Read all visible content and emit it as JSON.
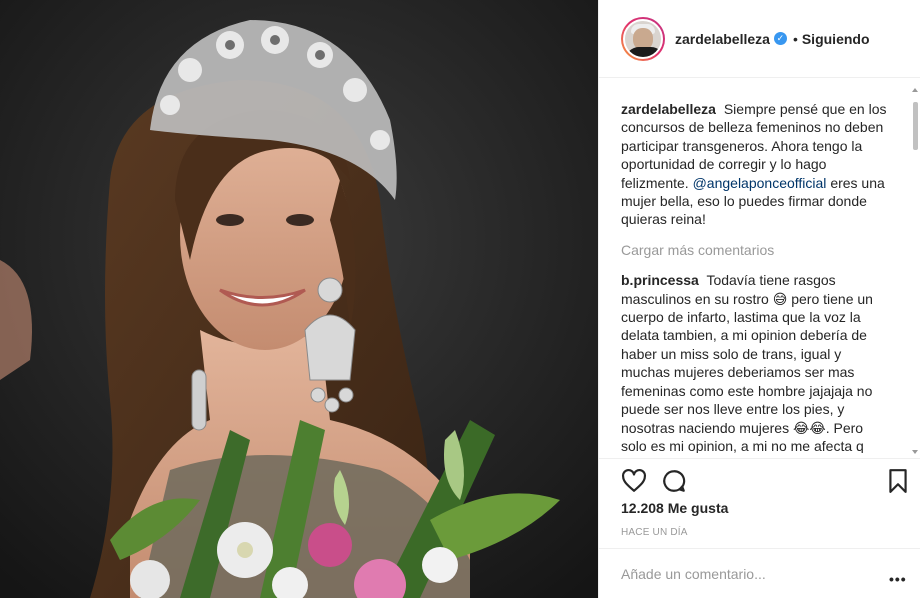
{
  "post": {
    "image_alt": "Mujer sonriente con corona y aretes largos, sosteniendo un ramo de flores"
  },
  "header": {
    "username": "zardelabelleza",
    "verified_mark": "✓",
    "separator": "•",
    "follow_label": "Siguiendo",
    "avatar_icon": "profile-avatar"
  },
  "caption": {
    "author": "zardelabelleza",
    "text_before": "Siempre pensé que en los concursos de belleza femeninos no deben participar transgeneros. Ahora tengo la oportunidad de corregir y lo hago felizmente.",
    "mention": "@angelaponceofficial",
    "text_after": "eres una mujer bella, eso lo puedes firmar donde quieras reina!"
  },
  "load_more_label": "Cargar más comentarios",
  "comments": [
    {
      "author": "b.princessa",
      "text": "Todavía tiene rasgos masculinos en su rostro 😅 pero tiene un cuerpo de infarto, lastima que la voz la delata tambien, a mi opinion debería de haber un miss solo de trans, igual y muchas mujeres deberiamos ser mas femeninas como este hombre jajajaja no puede ser nos lleve entre los pies, y nosotras naciendo mujeres 😂😂. Pero solo es mi opinion, a mi no me afecta q concurse asi es la vida no todo sera como queremos q"
    }
  ],
  "actions": {
    "like_icon": "heart-icon",
    "comment_icon": "comment-icon",
    "save_icon": "bookmark-icon"
  },
  "likes_text": "12.208 Me gusta",
  "time_ago": "HACE UN DÍA",
  "add_comment": {
    "placeholder": "Añade un comentario...",
    "more_label": "•••"
  },
  "colors": {
    "link": "#003569",
    "muted": "#999999",
    "text": "#262626",
    "verified": "#3897f0"
  }
}
